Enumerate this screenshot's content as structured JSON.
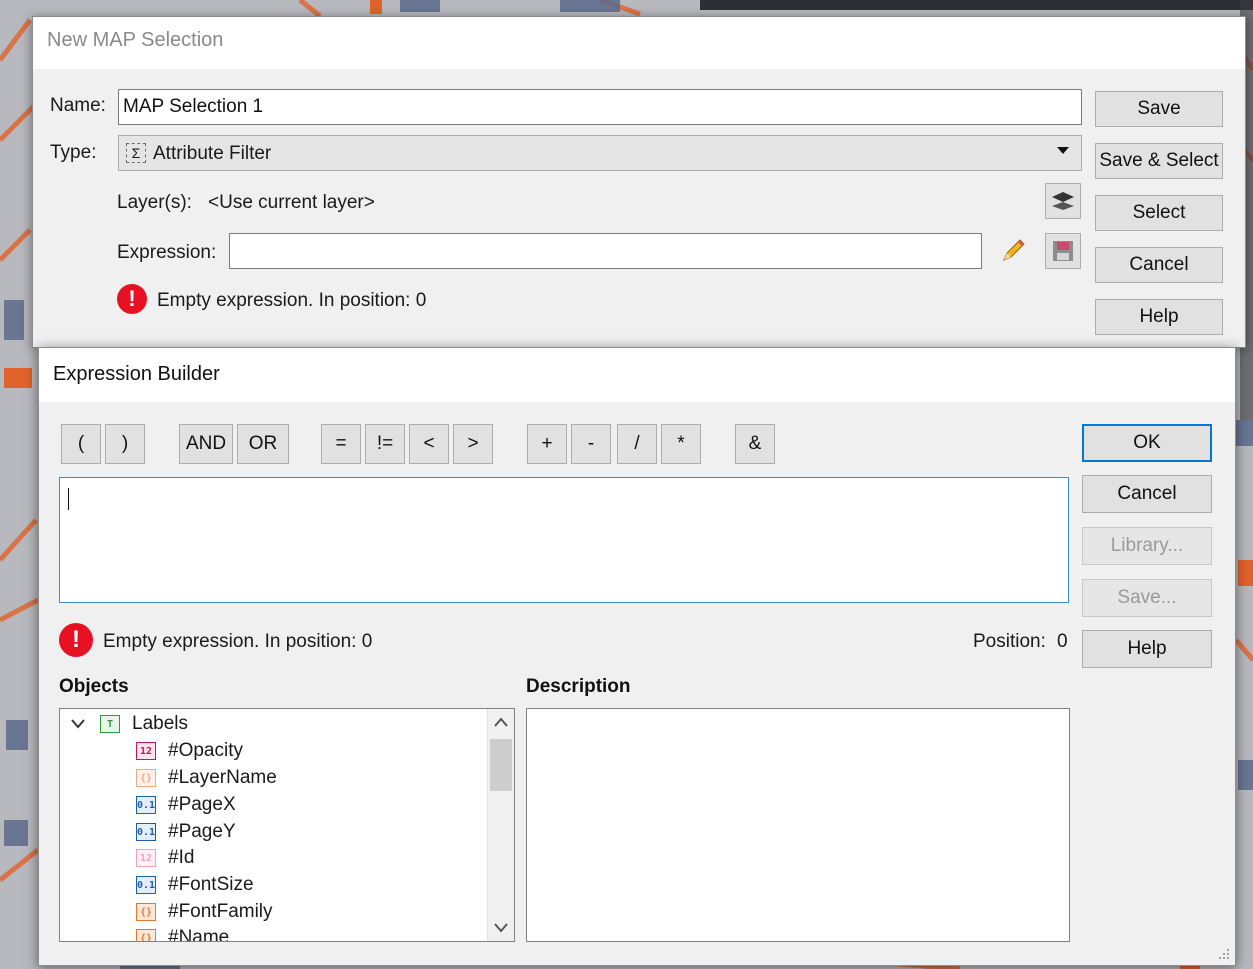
{
  "colors": {
    "accent": "#0078d7",
    "error": "#e81123",
    "map_orange": "#e2622b",
    "map_blue": "#5b6a8c"
  },
  "new_map_selection": {
    "title": "New MAP Selection",
    "name_label": "Name:",
    "name_value": "MAP Selection 1",
    "type_label": "Type:",
    "type_value": "Attribute Filter",
    "layers_label": "Layer(s):",
    "layers_value": "<Use current layer>",
    "expression_label": "Expression:",
    "expression_value": "",
    "error_text": "Empty expression. In position: 0",
    "buttons": {
      "save": "Save",
      "save_select": "Save & Select",
      "select": "Select",
      "cancel": "Cancel",
      "help": "Help"
    }
  },
  "expression_builder": {
    "title": "Expression Builder",
    "operators": [
      "(",
      ")",
      "AND",
      "OR",
      "=",
      "!=",
      "<",
      ">",
      "+",
      "-",
      "/",
      "*",
      "&"
    ],
    "expression_text": "",
    "error_text": "Empty expression. In position: 0",
    "position_label": "Position:",
    "position_value": "0",
    "buttons": {
      "ok": "OK",
      "cancel": "Cancel",
      "library": "Library...",
      "save": "Save...",
      "help": "Help"
    },
    "objects_header": "Objects",
    "description_header": "Description",
    "tree": {
      "root": {
        "label": "Labels",
        "icon": "T"
      },
      "items": [
        {
          "label": "#Opacity",
          "icon": "12",
          "icon_name": "integer-field-icon"
        },
        {
          "label": "#LayerName",
          "icon": "{}",
          "icon_name": "string-field-icon"
        },
        {
          "label": "#PageX",
          "icon": "0.1",
          "icon_name": "decimal-field-icon"
        },
        {
          "label": "#PageY",
          "icon": "0.1",
          "icon_name": "decimal-field-icon"
        },
        {
          "label": "#Id",
          "icon": "12",
          "icon_name": "integer-field-icon"
        },
        {
          "label": "#FontSize",
          "icon": "0.1",
          "icon_name": "decimal-field-icon"
        },
        {
          "label": "#FontFamily",
          "icon": "{}",
          "icon_name": "string-field-icon"
        },
        {
          "label": "#Name",
          "icon": "{}",
          "icon_name": "string-field-icon"
        }
      ]
    }
  }
}
